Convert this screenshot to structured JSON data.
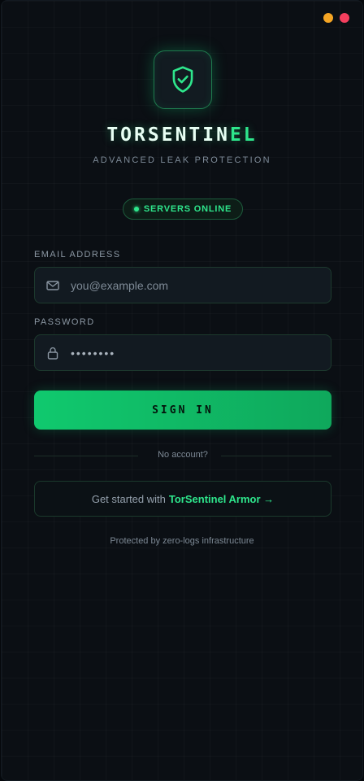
{
  "window": {
    "controls": [
      "minimize",
      "close"
    ],
    "colors": {
      "minimize": "#f5a524",
      "close": "#f43f5e"
    }
  },
  "brand": {
    "logo_icon": "shield-check-icon",
    "title_main": "TORSENTIN",
    "title_accent": "EL",
    "subtitle": "ADVANCED LEAK PROTECTION",
    "accent_color": "#2ee68c"
  },
  "status": {
    "text": "SERVERS ONLINE"
  },
  "form": {
    "email": {
      "label": "EMAIL ADDRESS",
      "placeholder": "you@example.com",
      "value": "",
      "icon": "mail-icon"
    },
    "password": {
      "label": "PASSWORD",
      "value": "••••••••",
      "icon": "lock-icon"
    },
    "submit_label": "SIGN IN"
  },
  "divider": {
    "text": "No account?"
  },
  "cta": {
    "prefix": "Get started with",
    "brand_link": "TorSentinel Armor →"
  },
  "footer": {
    "text": "Protected by zero-logs infrastructure"
  }
}
